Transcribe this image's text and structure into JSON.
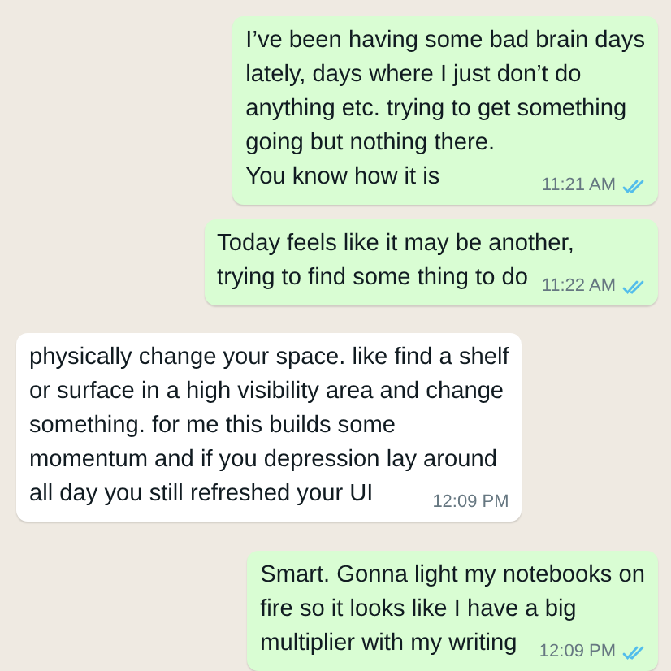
{
  "messages": [
    {
      "kind": "outgoing",
      "text": "I’ve been having some bad brain days\nlately, days where I just don’t do\nanything etc. trying to get something\ngoing but nothing there.\nYou know how it is",
      "time": "11:21 AM",
      "read": true
    },
    {
      "kind": "outgoing",
      "text": "Today feels like it may be another,\ntrying to find some thing to do",
      "time": "11:22 AM",
      "read": true
    },
    {
      "kind": "incoming",
      "text": "physically change your space. like find a shelf\nor surface in a high visibility area and change\nsomething. for me this builds some\nmomentum and if you depression lay around\nall day you still refreshed your UI",
      "time": "12:09 PM"
    },
    {
      "kind": "outgoing",
      "text": "Smart. Gonna light my notebooks on\nfire so it looks like I have a big\nmultiplier with my writing",
      "time": "12:09 PM",
      "read": true
    }
  ]
}
